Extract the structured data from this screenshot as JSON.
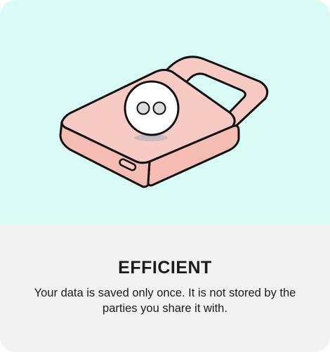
{
  "card": {
    "title": "EFFICIENT",
    "description": "Your data is saved only once. It is not stored by the parties you share it with."
  },
  "illustration": {
    "icon": "padlock-icon",
    "colors": {
      "hero_background": "#dafbf5",
      "lock_body": "#f7cbc3",
      "lock_body_side": "#f4bcb2",
      "shackle": "#f7cbc3",
      "outline": "#111111",
      "face_disc": "#ffffff",
      "eyes": "#dcdcdc",
      "shadow": "#bbbbbb"
    }
  },
  "colors": {
    "panel_background": "#f2f2f2",
    "text": "#1b1b1b"
  }
}
